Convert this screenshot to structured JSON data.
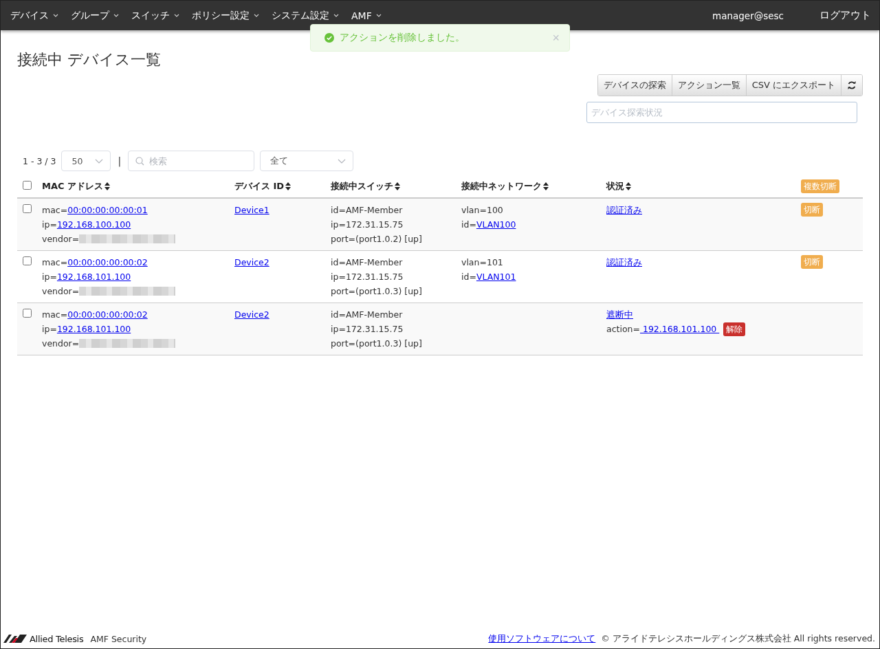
{
  "nav": {
    "items": [
      {
        "label": "デバイス"
      },
      {
        "label": "グループ"
      },
      {
        "label": "スイッチ"
      },
      {
        "label": "ポリシー設定"
      },
      {
        "label": "システム設定"
      },
      {
        "label": "AMF"
      }
    ],
    "user": "manager@sesc",
    "logout": "ログアウト"
  },
  "toast": {
    "message": "アクションを削除しました。",
    "close": "×"
  },
  "page": {
    "title": "接続中 デバイス一覧",
    "buttons": [
      "デバイスの探索",
      "アクション一覧",
      "CSV にエクスポート"
    ],
    "discovery_status": {
      "placeholder": "デバイス探索状況"
    }
  },
  "toolbar": {
    "count": "1 - 3 / 3",
    "page_size": "50",
    "separator": "|",
    "search": {
      "placeholder": "検索"
    },
    "filter": "全て"
  },
  "table": {
    "select_all": {
      "checked": false
    },
    "columns": [
      "MAC アドレス",
      "デバイス ID",
      "接続中スイッチ",
      "接続中ネットワーク",
      "状況"
    ],
    "bulk_action": "複数切断",
    "rows": [
      {
        "checked": false,
        "mac_label": "mac=",
        "mac": "00:00:00:00:00:01",
        "ip_label": "ip=",
        "ip": "192.168.100.100",
        "vendor_label": "vendor=",
        "device": "Device1",
        "switch": [
          "id=AMF-Member",
          "ip=172.31.15.75",
          "port=(port1.0.2) [up]"
        ],
        "vlan": "vlan=100",
        "net_id_label": "id=",
        "net_id": "VLAN100",
        "status": "認証済み",
        "action": {
          "kind": "disconnect",
          "label": "切断"
        }
      },
      {
        "checked": false,
        "mac_label": "mac=",
        "mac": "00:00:00:00:00:02",
        "ip_label": "ip=",
        "ip": "192.168.101.100",
        "vendor_label": "vendor=",
        "device": "Device2",
        "switch": [
          "id=AMF-Member",
          "ip=172.31.15.75",
          "port=(port1.0.3) [up]"
        ],
        "vlan": "vlan=101",
        "net_id_label": "id=",
        "net_id": "VLAN101",
        "status": "認証済み",
        "action": {
          "kind": "disconnect",
          "label": "切断"
        }
      },
      {
        "checked": false,
        "mac_label": "mac=",
        "mac": "00:00:00:00:00:02",
        "ip_label": "ip=",
        "ip": "192.168.101.100",
        "vendor_label": "vendor=",
        "device": "Device2",
        "switch": [
          "id=AMF-Member",
          "ip=172.31.15.75",
          "port=(port1.0.3) [up]"
        ],
        "status": "遮断中",
        "blocked_action": {
          "label": "action=",
          "target": " 192.168.101.100 ",
          "release": "解除"
        }
      }
    ]
  },
  "footer": {
    "brand": "Allied Telesis",
    "product": "AMF Security",
    "link": "使用ソフトウェアについて",
    "copyright": "© アライドテレシスホールディングス株式会社 All rights reserved."
  }
}
